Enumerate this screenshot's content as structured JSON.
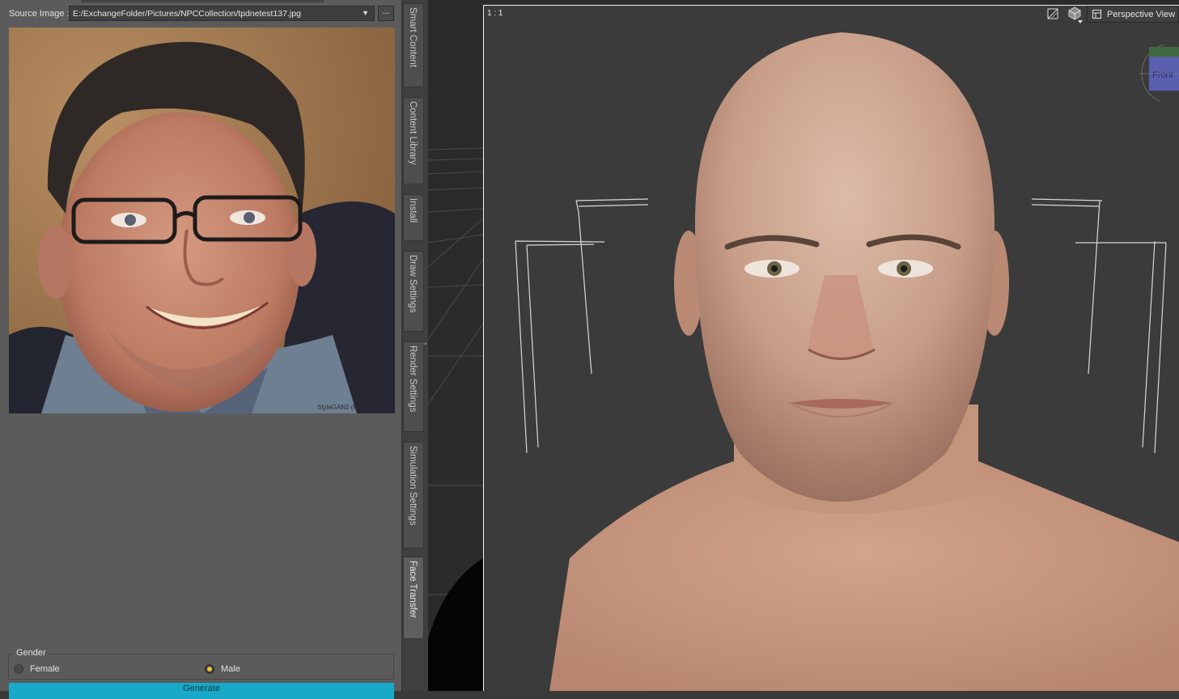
{
  "face_transfer_panel": {
    "source_label": "Source Image :",
    "source_path": "E:/ExchangeFolder/Pictures/NPCCollection/tpdnetest137.jpg",
    "browse_label": "...",
    "photo_credit": "StyleGAN2 (Karras e",
    "gender": {
      "title": "Gender",
      "options": [
        "Female",
        "Male"
      ],
      "selected": "Male"
    },
    "generate_label": "Generate"
  },
  "side_tabs": [
    "Smart Content",
    "Content Library",
    "Install",
    "Draw Settings",
    "Render Settings",
    "Simulation Settings",
    "Face Transfer"
  ],
  "active_tab": "Face Transfer",
  "viewport": {
    "zoom_readout": "1 : 1",
    "view_name": "Perspective View",
    "cube_face": "Front"
  },
  "colors": {
    "accent": "#17a9c7",
    "radio_selected": "#f2c32c",
    "panel_bg": "#5b5b5b",
    "viewport_bg": "#3a3a3a"
  }
}
